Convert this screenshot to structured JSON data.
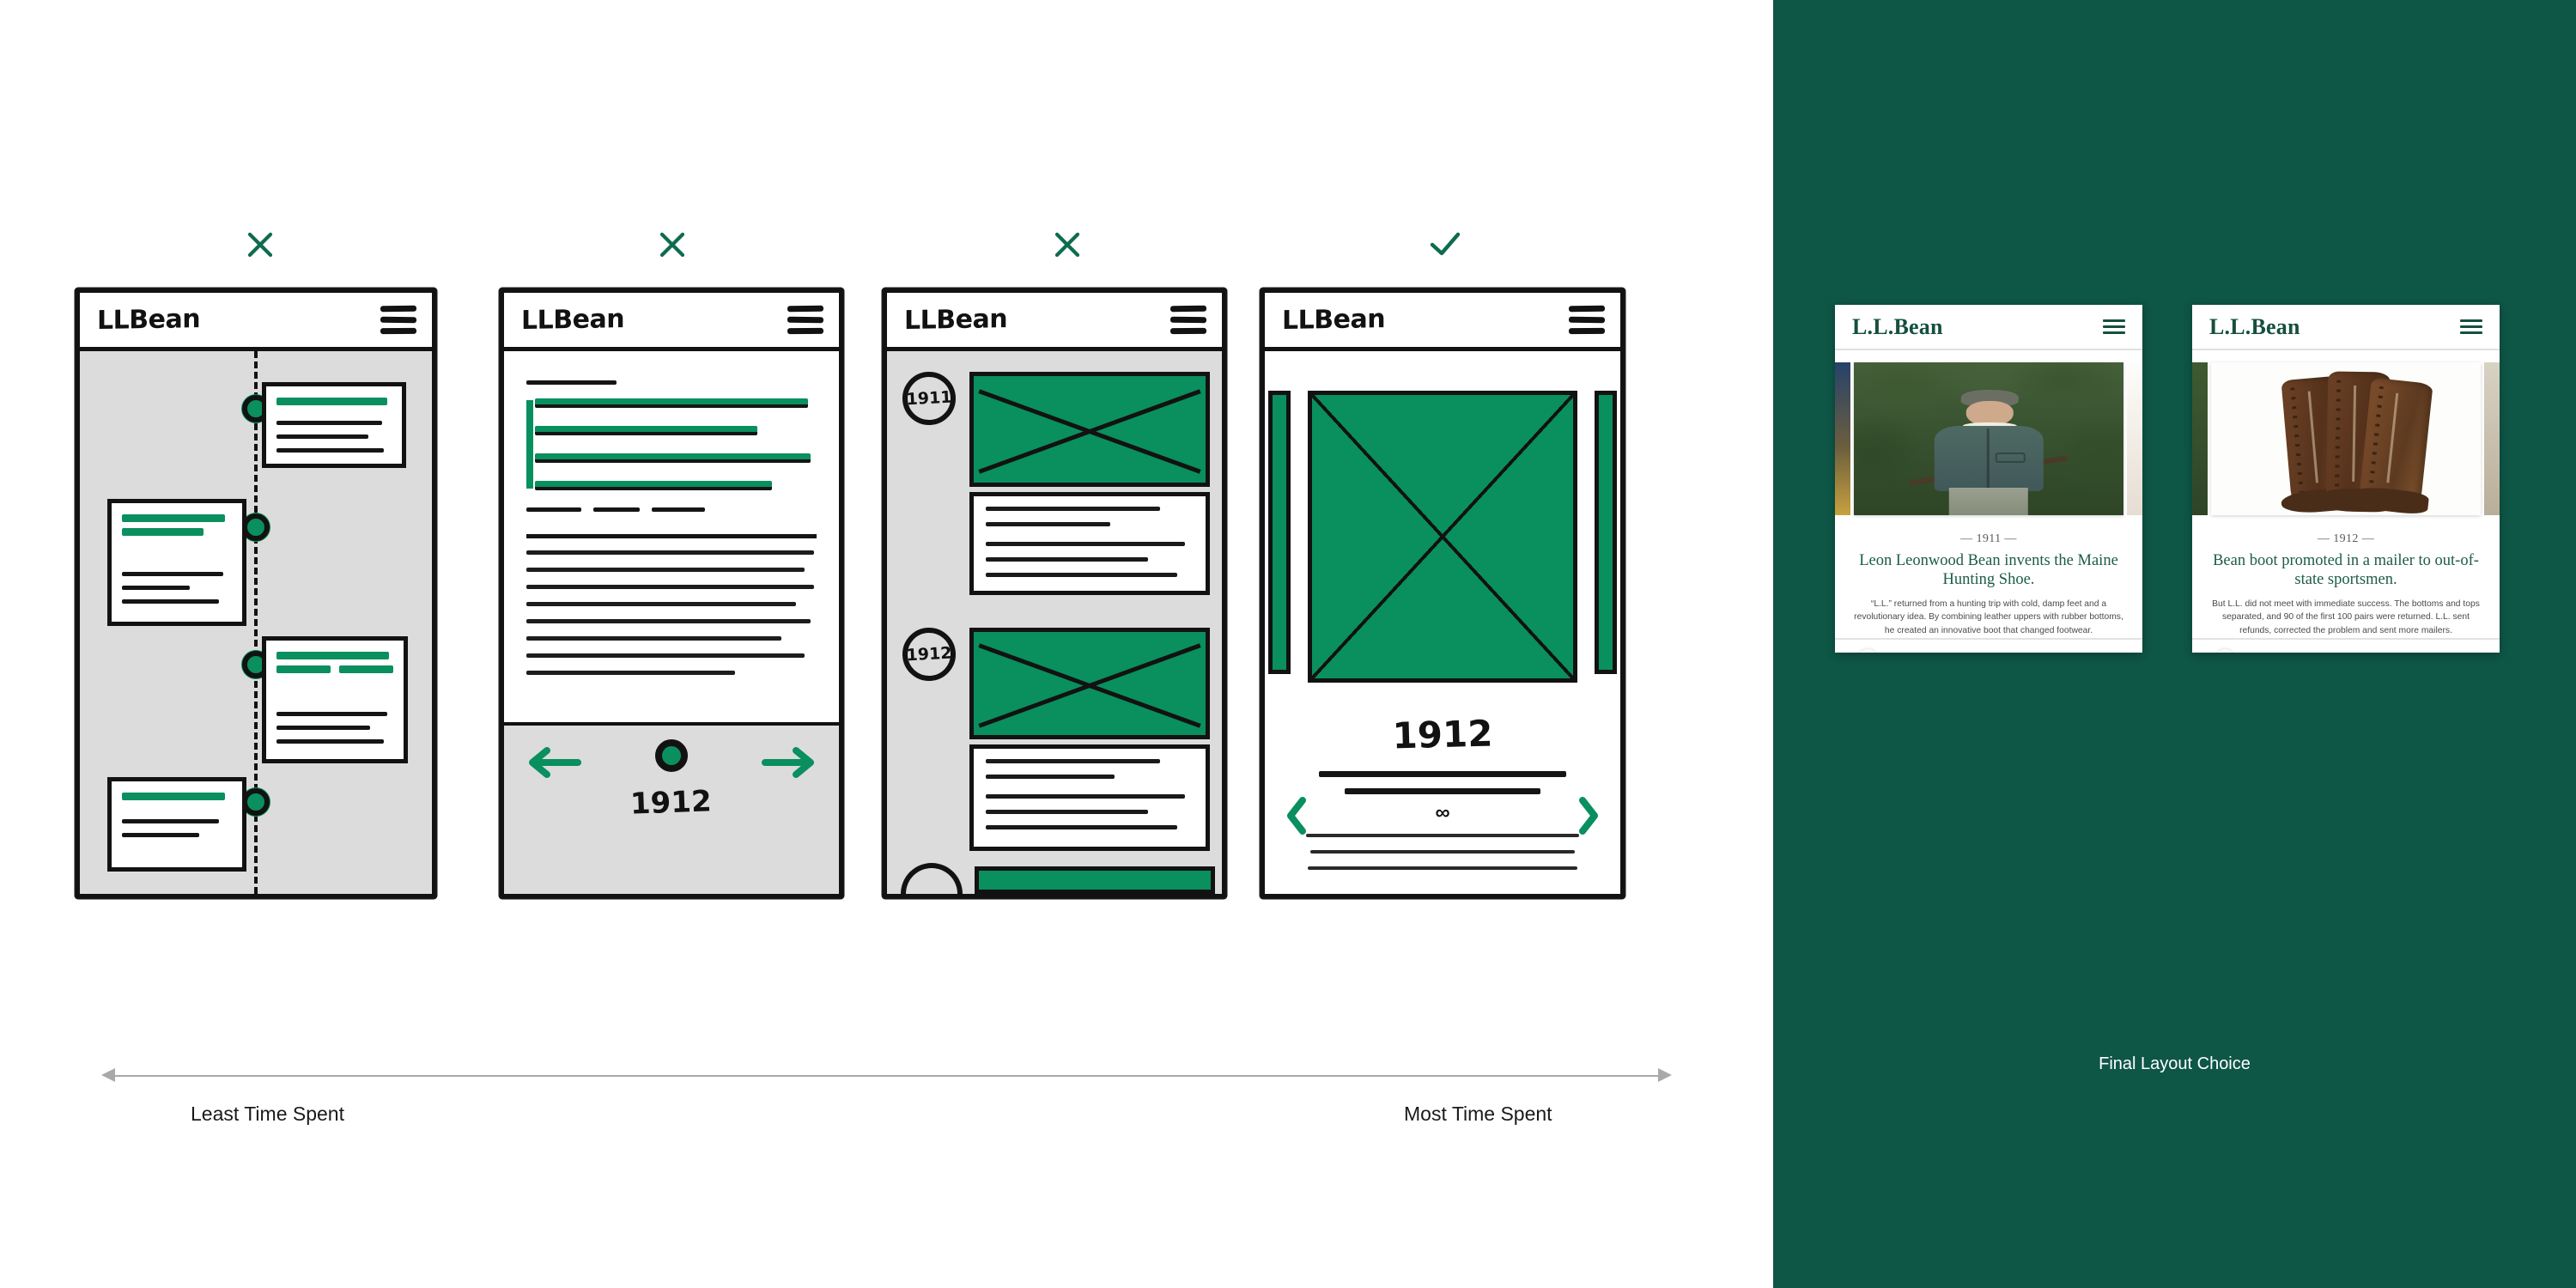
{
  "left": {
    "wireframes": [
      {
        "id": "vertical-timeline",
        "verdict": "reject",
        "verdict_icon": "x-icon",
        "logo": "LLBean",
        "menu_icon": "hamburger-icon"
      },
      {
        "id": "long-form-text",
        "verdict": "reject",
        "verdict_icon": "x-icon",
        "logo": "LLBean",
        "menu_icon": "hamburger-icon",
        "year": "1912",
        "prev_icon": "arrow-left-icon",
        "next_icon": "arrow-right-icon",
        "knob_icon": "slider-knob-icon"
      },
      {
        "id": "year-badge-stack",
        "verdict": "reject",
        "verdict_icon": "x-icon",
        "logo": "LLBean",
        "menu_icon": "hamburger-icon",
        "years": [
          "1911",
          "1912"
        ]
      },
      {
        "id": "hero-carousel",
        "verdict": "accept",
        "verdict_icon": "check-icon",
        "logo": "LLBean",
        "menu_icon": "hamburger-icon",
        "year": "1912",
        "prev_icon": "chevron-left-icon",
        "next_icon": "chevron-right-icon",
        "infinity_glyph": "∞"
      }
    ],
    "axis": {
      "left_label": "Least Time Spent",
      "right_label": "Most Time Spent",
      "left_arrow_icon": "arrow-left-icon",
      "right_arrow_icon": "arrow-right-icon"
    }
  },
  "right": {
    "caption": "Final Layout Choice",
    "background_color": "#0e5646",
    "brand_green": "#15503f",
    "phones": [
      {
        "logo": "L.L.Bean",
        "menu_icon": "hamburger-icon",
        "image_alt": "portrait-of-leon-leonwood-bean-in-forest",
        "year": "— 1911 —",
        "title": "Leon Leonwood Bean invents the Maine Hunting Shoe.",
        "body": "“L.L.” returned from a hunting trip with cold, damp feet and a revolutionary idea. By combining leather uppers with rubber bottoms, he created an innovative boot that changed footwear.",
        "slider_icon": "timeline-slider"
      },
      {
        "logo": "L.L.Bean",
        "menu_icon": "hamburger-icon",
        "image_alt": "vintage-leather-bean-boots",
        "year": "— 1912 —",
        "title": "Bean boot promoted in a mailer to out-of-state sportsmen.",
        "body": "But L.L. did not meet with immediate success. The bottoms and tops separated, and 90 of the first 100 pairs were returned. L.L. sent refunds, corrected the problem and sent more mailers.",
        "slider_icon": "timeline-slider"
      }
    ]
  }
}
